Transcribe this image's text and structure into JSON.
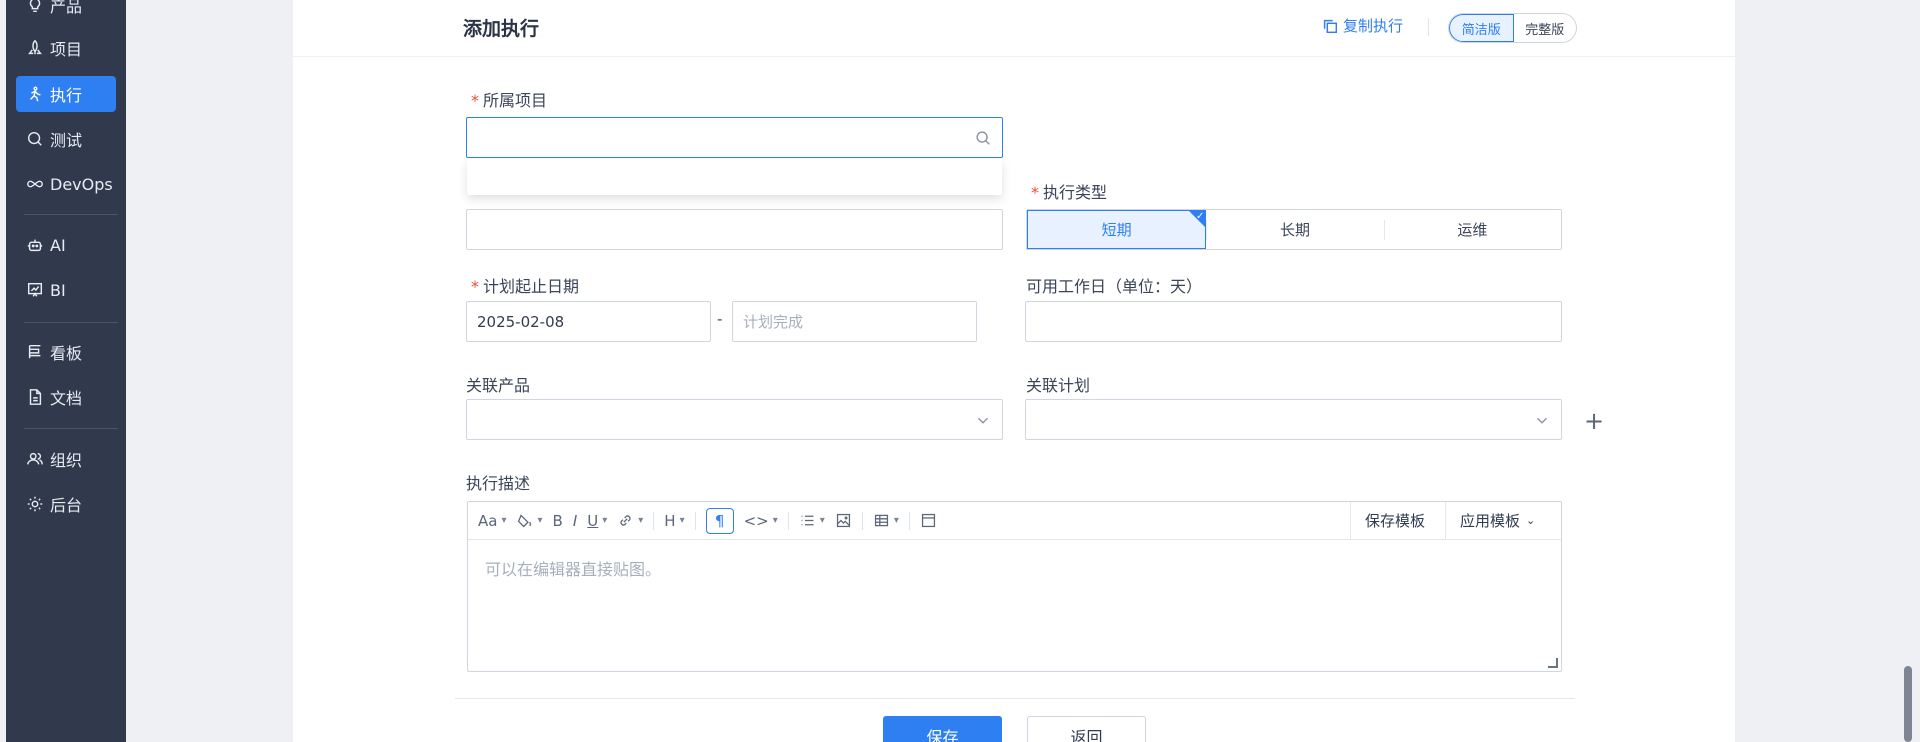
{
  "sidebar": {
    "items": [
      {
        "label": "产品",
        "icon": "bulb-icon"
      },
      {
        "label": "项目",
        "icon": "rocket-icon"
      },
      {
        "label": "执行",
        "icon": "run-icon",
        "active": true
      },
      {
        "label": "测试",
        "icon": "test-icon"
      },
      {
        "label": "DevOps",
        "icon": "infinity-icon"
      },
      {
        "label": "AI",
        "icon": "robot-icon"
      },
      {
        "label": "BI",
        "icon": "chart-board-icon"
      },
      {
        "label": "看板",
        "icon": "kanban-icon"
      },
      {
        "label": "文档",
        "icon": "doc-icon"
      },
      {
        "label": "组织",
        "icon": "users-icon"
      },
      {
        "label": "后台",
        "icon": "gear-icon"
      }
    ]
  },
  "header": {
    "title": "添加执行",
    "copy_label": "复制执行",
    "version_simple": "简洁版",
    "version_full": "完整版"
  },
  "form": {
    "project_label": "所属项目",
    "type_label": "执行类型",
    "type_options": [
      "短期",
      "长期",
      "运维"
    ],
    "type_selected": "短期",
    "date_label": "计划起止日期",
    "start_date": "2025-02-08",
    "date_sep": "-",
    "end_placeholder": "计划完成",
    "workdays_label": "可用工作日（单位：天）",
    "product_label": "关联产品",
    "plan_label": "关联计划",
    "plus": "+",
    "desc_label": "执行描述",
    "desc_placeholder": "可以在编辑器直接贴图。"
  },
  "editor": {
    "save_template": "保存模板",
    "apply_template": "应用模板"
  },
  "footer": {
    "save": "保存",
    "back": "返回"
  },
  "colors": {
    "sidebar_bg": "#313a4d",
    "accent": "#2e7ff2",
    "required": "#e84e3f"
  }
}
